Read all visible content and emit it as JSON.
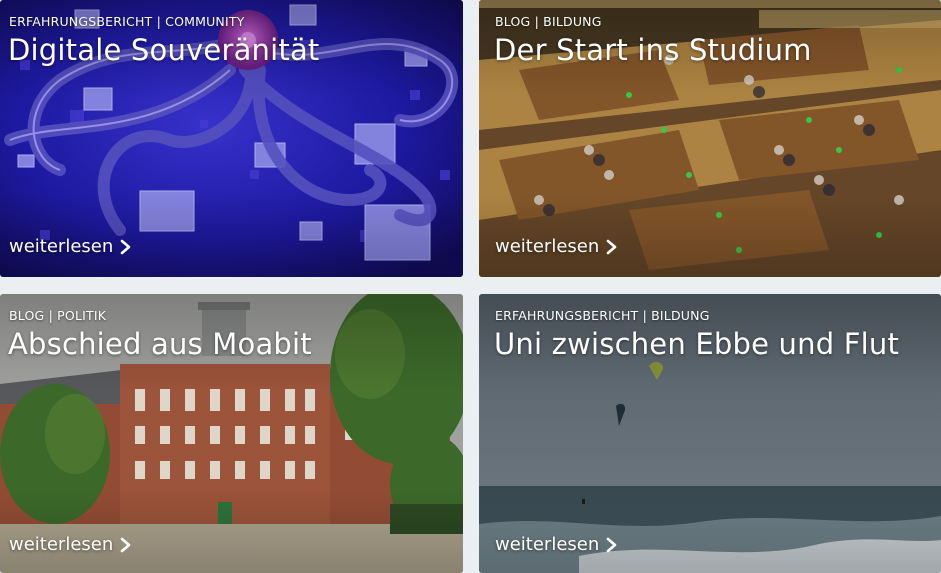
{
  "cards": [
    {
      "category": "ERFAHRUNGSBERICHT | COMMUNITY",
      "title": "Digitale Souveränität",
      "link": "weiterlesen"
    },
    {
      "category": "BLOG | BILDUNG",
      "title": "Der Start ins Studium",
      "link": "weiterlesen"
    },
    {
      "category": "BLOG | POLITIK",
      "title": "Abschied aus Moabit",
      "link": "weiterlesen"
    },
    {
      "category": "ERFAHRUNGSBERICHT | BILDUNG",
      "title": "Uni zwischen Ebbe und Flut",
      "link": "weiterlesen"
    }
  ],
  "icons": {
    "link_arrow": "chevron-right-icon"
  },
  "colors": {
    "page_background": "#eceff2",
    "text": "#ffffff"
  }
}
